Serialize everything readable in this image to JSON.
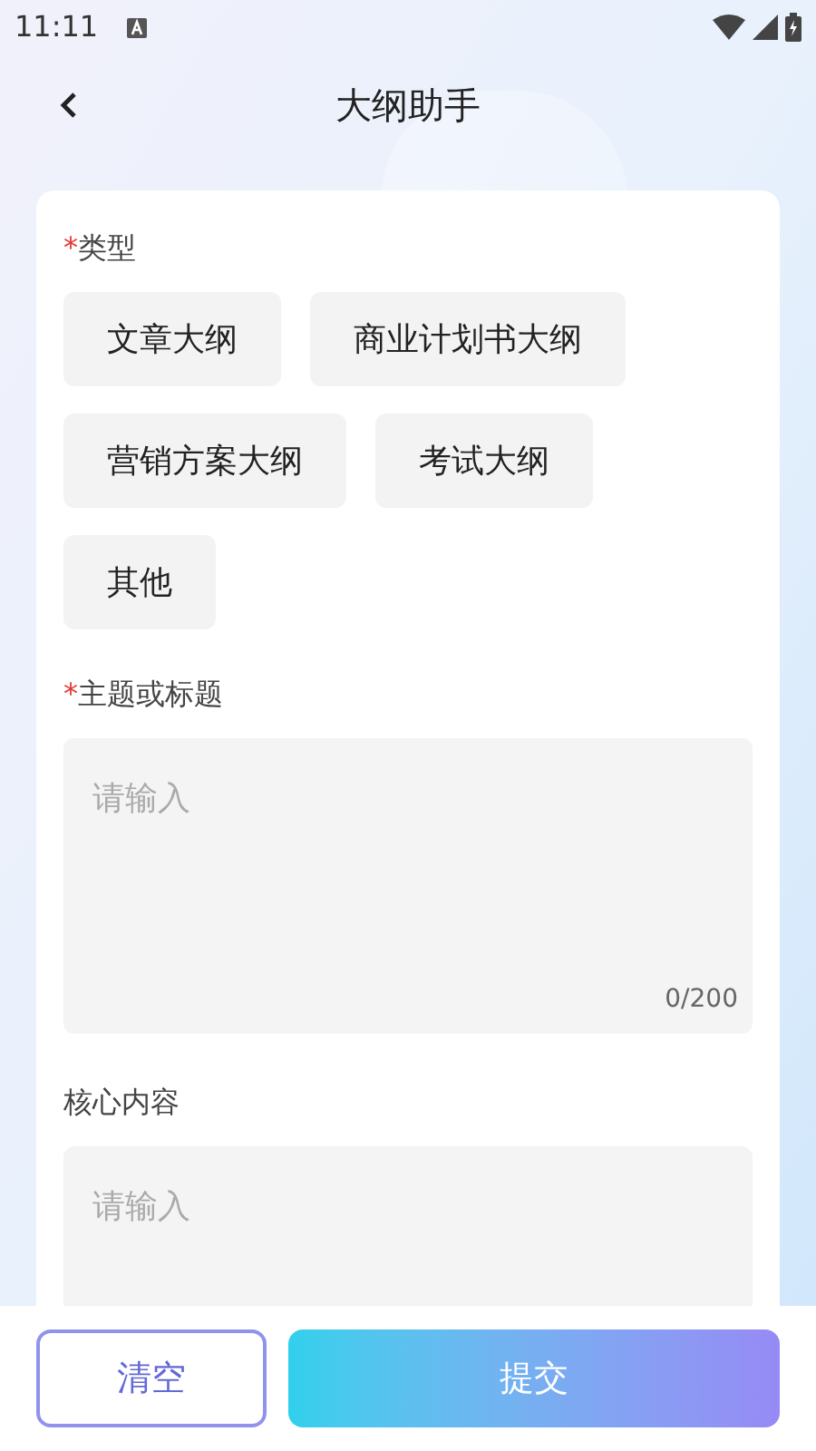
{
  "status_bar": {
    "time": "11:11"
  },
  "header": {
    "title": "大纲助手"
  },
  "type_field": {
    "label": "类型",
    "required_mark": "*",
    "options": [
      {
        "label": "文章大纲",
        "selected": false
      },
      {
        "label": "商业计划书大纲",
        "selected": false
      },
      {
        "label": "营销方案大纲",
        "selected": false
      },
      {
        "label": "考试大纲",
        "selected": false
      },
      {
        "label": "其他",
        "selected": false
      }
    ]
  },
  "topic_field": {
    "label": "主题或标题",
    "required_mark": "*",
    "placeholder": "请输入",
    "counter": "0/200"
  },
  "content_field": {
    "label": "核心内容",
    "placeholder": "请输入"
  },
  "buttons": {
    "clear": "清空",
    "submit": "提交"
  }
}
